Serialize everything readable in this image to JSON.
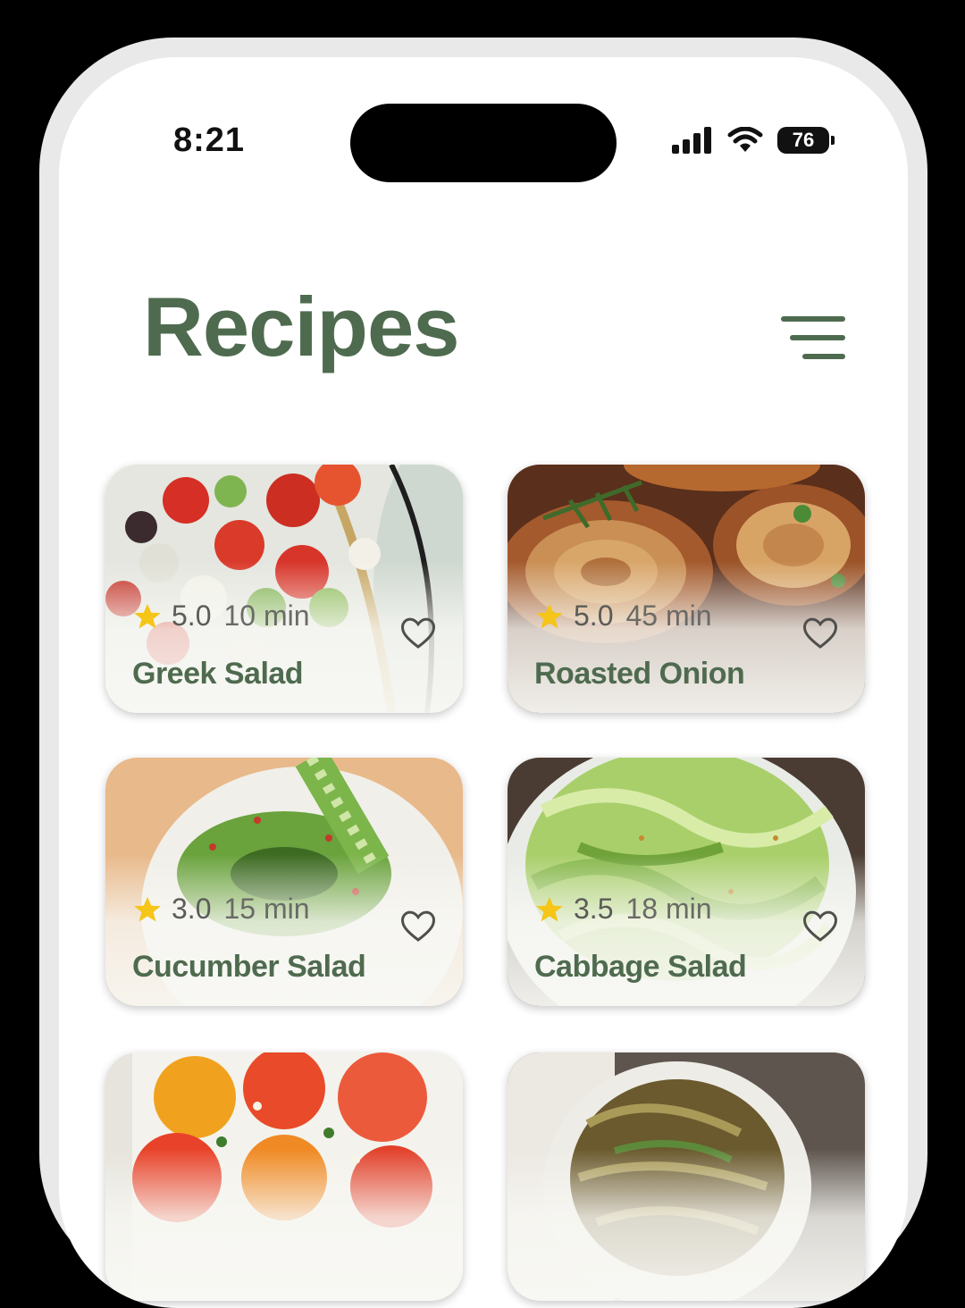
{
  "status_bar": {
    "time": "8:21",
    "battery": "76"
  },
  "header": {
    "title": "Recipes"
  },
  "recipes": [
    {
      "name": "Greek Salad",
      "rating": "5.0",
      "time": "10 min"
    },
    {
      "name": "Roasted Onion",
      "rating": "5.0",
      "time": "45 min"
    },
    {
      "name": "Cucumber Salad",
      "rating": "3.0",
      "time": "15 min"
    },
    {
      "name": "Cabbage Salad",
      "rating": "3.5",
      "time": "18 min"
    }
  ],
  "colors": {
    "accent": "#4f6b4f",
    "star": "#f5c518"
  },
  "icons": {
    "menu": "hamburger-menu-icon",
    "favorite": "heart-outline-icon",
    "rating": "star-icon"
  }
}
